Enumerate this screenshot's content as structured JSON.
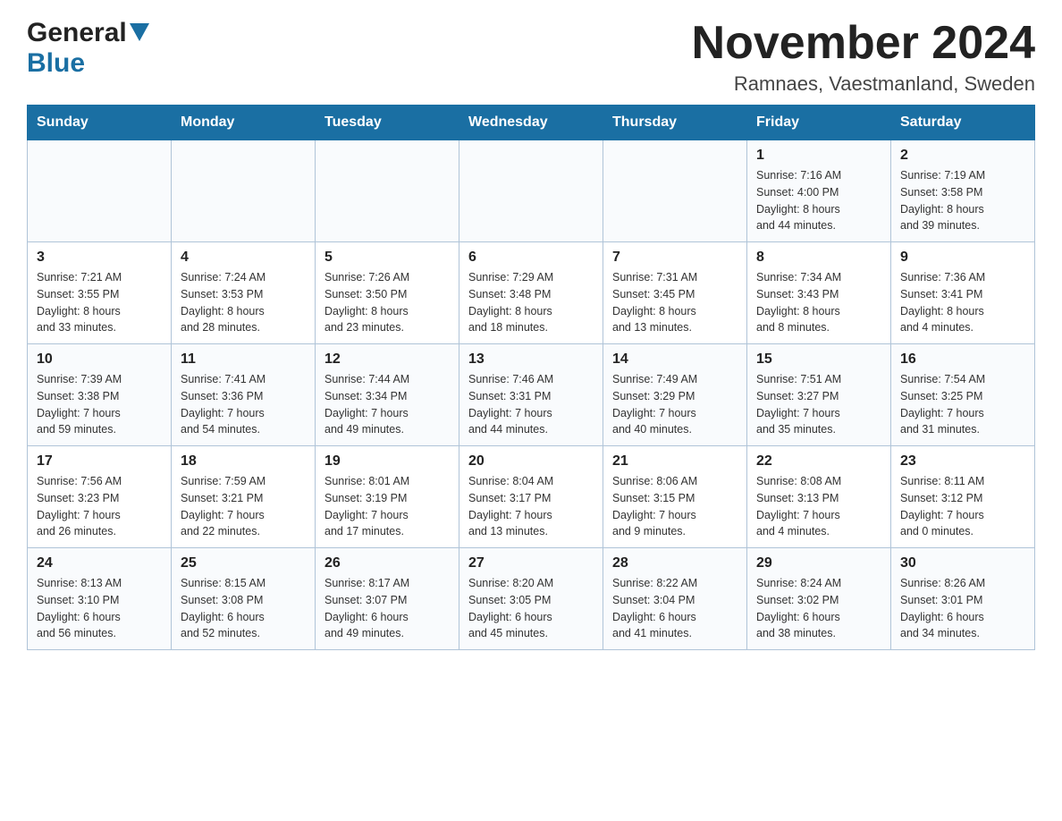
{
  "logo": {
    "general": "General",
    "triangle": "▶",
    "blue": "Blue"
  },
  "title": "November 2024",
  "subtitle": "Ramnaes, Vaestmanland, Sweden",
  "weekdays": [
    "Sunday",
    "Monday",
    "Tuesday",
    "Wednesday",
    "Thursday",
    "Friday",
    "Saturday"
  ],
  "weeks": [
    [
      {
        "day": "",
        "info": ""
      },
      {
        "day": "",
        "info": ""
      },
      {
        "day": "",
        "info": ""
      },
      {
        "day": "",
        "info": ""
      },
      {
        "day": "",
        "info": ""
      },
      {
        "day": "1",
        "info": "Sunrise: 7:16 AM\nSunset: 4:00 PM\nDaylight: 8 hours\nand 44 minutes."
      },
      {
        "day": "2",
        "info": "Sunrise: 7:19 AM\nSunset: 3:58 PM\nDaylight: 8 hours\nand 39 minutes."
      }
    ],
    [
      {
        "day": "3",
        "info": "Sunrise: 7:21 AM\nSunset: 3:55 PM\nDaylight: 8 hours\nand 33 minutes."
      },
      {
        "day": "4",
        "info": "Sunrise: 7:24 AM\nSunset: 3:53 PM\nDaylight: 8 hours\nand 28 minutes."
      },
      {
        "day": "5",
        "info": "Sunrise: 7:26 AM\nSunset: 3:50 PM\nDaylight: 8 hours\nand 23 minutes."
      },
      {
        "day": "6",
        "info": "Sunrise: 7:29 AM\nSunset: 3:48 PM\nDaylight: 8 hours\nand 18 minutes."
      },
      {
        "day": "7",
        "info": "Sunrise: 7:31 AM\nSunset: 3:45 PM\nDaylight: 8 hours\nand 13 minutes."
      },
      {
        "day": "8",
        "info": "Sunrise: 7:34 AM\nSunset: 3:43 PM\nDaylight: 8 hours\nand 8 minutes."
      },
      {
        "day": "9",
        "info": "Sunrise: 7:36 AM\nSunset: 3:41 PM\nDaylight: 8 hours\nand 4 minutes."
      }
    ],
    [
      {
        "day": "10",
        "info": "Sunrise: 7:39 AM\nSunset: 3:38 PM\nDaylight: 7 hours\nand 59 minutes."
      },
      {
        "day": "11",
        "info": "Sunrise: 7:41 AM\nSunset: 3:36 PM\nDaylight: 7 hours\nand 54 minutes."
      },
      {
        "day": "12",
        "info": "Sunrise: 7:44 AM\nSunset: 3:34 PM\nDaylight: 7 hours\nand 49 minutes."
      },
      {
        "day": "13",
        "info": "Sunrise: 7:46 AM\nSunset: 3:31 PM\nDaylight: 7 hours\nand 44 minutes."
      },
      {
        "day": "14",
        "info": "Sunrise: 7:49 AM\nSunset: 3:29 PM\nDaylight: 7 hours\nand 40 minutes."
      },
      {
        "day": "15",
        "info": "Sunrise: 7:51 AM\nSunset: 3:27 PM\nDaylight: 7 hours\nand 35 minutes."
      },
      {
        "day": "16",
        "info": "Sunrise: 7:54 AM\nSunset: 3:25 PM\nDaylight: 7 hours\nand 31 minutes."
      }
    ],
    [
      {
        "day": "17",
        "info": "Sunrise: 7:56 AM\nSunset: 3:23 PM\nDaylight: 7 hours\nand 26 minutes."
      },
      {
        "day": "18",
        "info": "Sunrise: 7:59 AM\nSunset: 3:21 PM\nDaylight: 7 hours\nand 22 minutes."
      },
      {
        "day": "19",
        "info": "Sunrise: 8:01 AM\nSunset: 3:19 PM\nDaylight: 7 hours\nand 17 minutes."
      },
      {
        "day": "20",
        "info": "Sunrise: 8:04 AM\nSunset: 3:17 PM\nDaylight: 7 hours\nand 13 minutes."
      },
      {
        "day": "21",
        "info": "Sunrise: 8:06 AM\nSunset: 3:15 PM\nDaylight: 7 hours\nand 9 minutes."
      },
      {
        "day": "22",
        "info": "Sunrise: 8:08 AM\nSunset: 3:13 PM\nDaylight: 7 hours\nand 4 minutes."
      },
      {
        "day": "23",
        "info": "Sunrise: 8:11 AM\nSunset: 3:12 PM\nDaylight: 7 hours\nand 0 minutes."
      }
    ],
    [
      {
        "day": "24",
        "info": "Sunrise: 8:13 AM\nSunset: 3:10 PM\nDaylight: 6 hours\nand 56 minutes."
      },
      {
        "day": "25",
        "info": "Sunrise: 8:15 AM\nSunset: 3:08 PM\nDaylight: 6 hours\nand 52 minutes."
      },
      {
        "day": "26",
        "info": "Sunrise: 8:17 AM\nSunset: 3:07 PM\nDaylight: 6 hours\nand 49 minutes."
      },
      {
        "day": "27",
        "info": "Sunrise: 8:20 AM\nSunset: 3:05 PM\nDaylight: 6 hours\nand 45 minutes."
      },
      {
        "day": "28",
        "info": "Sunrise: 8:22 AM\nSunset: 3:04 PM\nDaylight: 6 hours\nand 41 minutes."
      },
      {
        "day": "29",
        "info": "Sunrise: 8:24 AM\nSunset: 3:02 PM\nDaylight: 6 hours\nand 38 minutes."
      },
      {
        "day": "30",
        "info": "Sunrise: 8:26 AM\nSunset: 3:01 PM\nDaylight: 6 hours\nand 34 minutes."
      }
    ]
  ]
}
